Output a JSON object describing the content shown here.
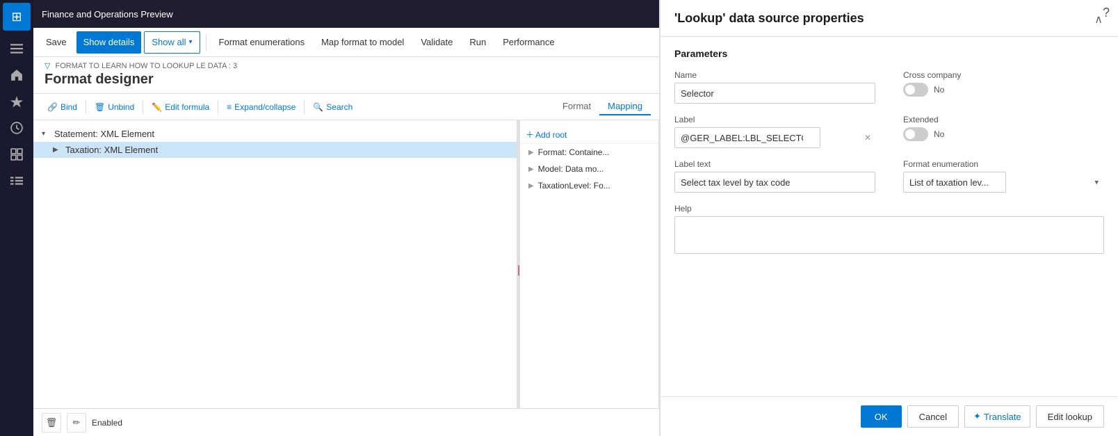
{
  "app": {
    "title": "Finance and Operations Preview",
    "help_icon": "?"
  },
  "sidebar": {
    "icons": [
      {
        "name": "apps-icon",
        "symbol": "⊞"
      },
      {
        "name": "home-icon",
        "symbol": "⌂"
      },
      {
        "name": "star-icon",
        "symbol": "★"
      },
      {
        "name": "clock-icon",
        "symbol": "○"
      },
      {
        "name": "calendar-icon",
        "symbol": "▦"
      },
      {
        "name": "list-icon",
        "symbol": "≡"
      }
    ]
  },
  "toolbar": {
    "save_label": "Save",
    "show_details_label": "Show details",
    "show_all_label": "Show all",
    "format_enumerations_label": "Format enumerations",
    "map_format_label": "Map format to model",
    "validate_label": "Validate",
    "run_label": "Run",
    "performance_label": "Performance"
  },
  "page": {
    "breadcrumb": "FORMAT TO LEARN HOW TO LOOKUP LE DATA : 3",
    "title": "Format designer"
  },
  "action_toolbar": {
    "bind_label": "Bind",
    "unbind_label": "Unbind",
    "edit_formula_label": "Edit formula",
    "expand_collapse_label": "Expand/collapse",
    "search_label": "Search",
    "add_root_label": "Add root",
    "format_tab": "Format",
    "mapping_tab": "Mapping"
  },
  "tree": {
    "items": [
      {
        "label": "Statement: XML Element",
        "indent": 0,
        "toggle": "▾",
        "selected": false
      },
      {
        "label": "Taxation: XML Element",
        "indent": 1,
        "toggle": "▶",
        "selected": true
      }
    ]
  },
  "mapping": {
    "items": [
      {
        "label": "Format: Containe..."
      },
      {
        "label": "Model: Data mo..."
      },
      {
        "label": "TaxationLevel: Fo..."
      }
    ]
  },
  "bottom_bar": {
    "enabled_label": "Enabled"
  },
  "right_panel": {
    "title": "'Lookup' data source properties",
    "section_title": "Parameters",
    "name_label": "Name",
    "name_value": "Selector",
    "cross_company_label": "Cross company",
    "cross_company_toggle": "off",
    "cross_company_value": "No",
    "label_label": "Label",
    "label_value": "@GER_LABEL:LBL_SELECTOR",
    "extended_label": "Extended",
    "extended_toggle": "off",
    "extended_value": "No",
    "label_text_label": "Label text",
    "label_text_value": "Select tax level by tax code",
    "format_enum_label": "Format enumeration",
    "format_enum_value": "List of taxation lev...",
    "help_label": "Help",
    "help_value": "",
    "ok_label": "OK",
    "cancel_label": "Cancel",
    "translate_label": "Translate",
    "edit_lookup_label": "Edit lookup"
  }
}
